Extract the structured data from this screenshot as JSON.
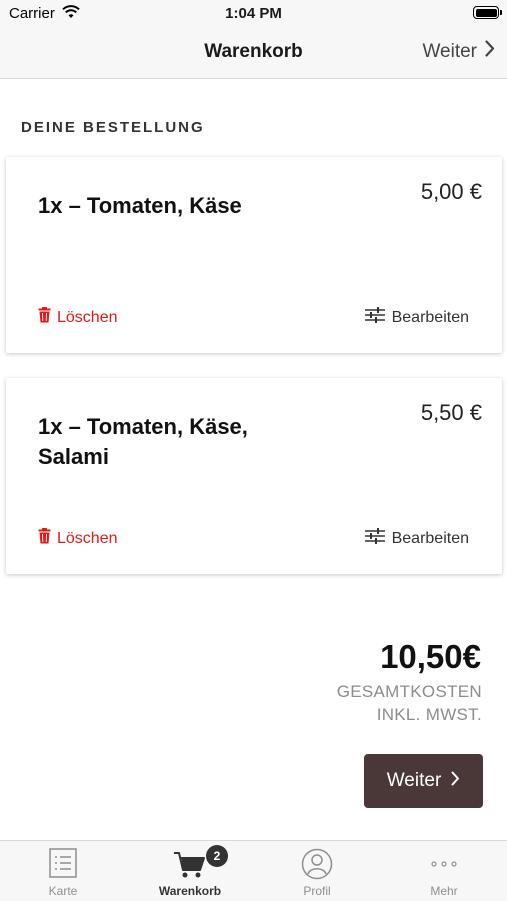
{
  "status_bar": {
    "carrier": "Carrier",
    "time": "1:04 PM"
  },
  "nav": {
    "title": "Warenkorb",
    "next_label": "Weiter"
  },
  "section_title": "DEINE BESTELLUNG",
  "items": [
    {
      "title": "1x – Tomaten, Käse",
      "price": "5,00 €",
      "delete_label": "Löschen",
      "edit_label": "Bearbeiten"
    },
    {
      "title": "1x – Tomaten, Käse, Salami",
      "price": "5,50 €",
      "delete_label": "Löschen",
      "edit_label": "Bearbeiten"
    }
  ],
  "total": {
    "value": "10,50€",
    "label_line1": "GESAMTKOSTEN",
    "label_line2": "INKL. MWST."
  },
  "checkout_button": {
    "label": "Weiter"
  },
  "tab_bar": {
    "tabs": [
      {
        "label": "Karte",
        "icon": "menu-list-icon"
      },
      {
        "label": "Warenkorb",
        "icon": "cart-icon",
        "badge": "2",
        "active": true
      },
      {
        "label": "Profil",
        "icon": "profile-icon"
      },
      {
        "label": "Mehr",
        "icon": "more-icon"
      }
    ]
  },
  "colors": {
    "accent": "#4a3838",
    "delete": "#e11a1a",
    "muted": "#8c8c8c"
  }
}
